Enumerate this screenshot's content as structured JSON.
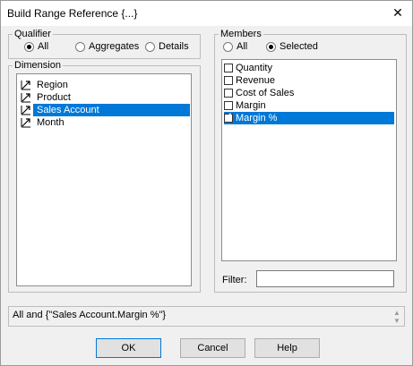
{
  "window": {
    "title": "Build Range Reference {...}"
  },
  "qualifier": {
    "legend": "Qualifier",
    "options": [
      {
        "label": "All",
        "selected": true
      },
      {
        "label": "Aggregates",
        "selected": false
      },
      {
        "label": "Details",
        "selected": false
      }
    ]
  },
  "dimension": {
    "legend": "Dimension",
    "items": [
      {
        "label": "Region",
        "selected": false
      },
      {
        "label": "Product",
        "selected": false
      },
      {
        "label": "Sales Account",
        "selected": true
      },
      {
        "label": "Month",
        "selected": false
      }
    ]
  },
  "members": {
    "legend": "Members",
    "options": [
      {
        "label": "All",
        "selected": false
      },
      {
        "label": "Selected",
        "selected": true
      }
    ],
    "items": [
      {
        "label": "Quantity",
        "checked": false,
        "selected": false
      },
      {
        "label": "Revenue",
        "checked": false,
        "selected": false
      },
      {
        "label": "Cost of Sales",
        "checked": false,
        "selected": false
      },
      {
        "label": "Margin",
        "checked": false,
        "selected": false
      },
      {
        "label": "Margin %",
        "checked": true,
        "selected": true
      }
    ],
    "filter_label": "Filter:",
    "filter_value": ""
  },
  "expression": "All and {\"Sales Account.Margin %\"}",
  "buttons": {
    "ok": "OK",
    "cancel": "Cancel",
    "help": "Help"
  },
  "colors": {
    "selection": "#0078d7"
  }
}
